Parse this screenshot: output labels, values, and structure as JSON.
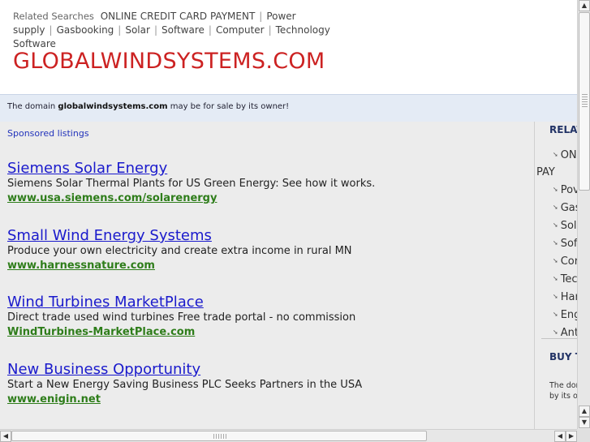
{
  "topbar": {
    "label": "Related Searches",
    "links": [
      "ONLINE CREDIT CARD PAYMENT",
      "Power supply",
      "Gasbooking",
      "Solar",
      "Software",
      "Computer",
      "Technology",
      "Software"
    ]
  },
  "site": {
    "title": "GLOBALWINDSYSTEMS.COM"
  },
  "notice": {
    "prefix": "The domain",
    "domain": "globalwindsystems.com",
    "suffix": "may be for sale by its owner!"
  },
  "main": {
    "sponsored_label": "Sponsored listings",
    "listings": [
      {
        "title": "Siemens Solar Energy",
        "desc": "Siemens Solar Thermal Plants for US Green Energy: See how it works.",
        "url": "www.usa.siemens.com/solarenergy"
      },
      {
        "title": "Small Wind Energy Systems",
        "desc": "Produce your own electricity and create extra income in rural MN",
        "url": "www.harnessnature.com"
      },
      {
        "title": "Wind Turbines MarketPlace",
        "desc": "Direct trade used wind turbines Free trade portal - no commission",
        "url": "WindTurbines-MarketPlace.com"
      },
      {
        "title": "New Business Opportunity",
        "desc": "Start a New Energy Saving Business PLC Seeks Partners in the USA",
        "url": "www.enigin.net"
      }
    ]
  },
  "right_panel": {
    "heading": "RELAT",
    "items": [
      "ON",
      "PAY",
      "Pov",
      "Gas",
      "Sol",
      "Sof",
      "Cor",
      "Tec",
      "Har",
      "Eng",
      "Ant"
    ],
    "heading2": "BUY T",
    "text_line1": "The dom",
    "text_line2": "by its ov"
  },
  "icons": {
    "bullet": "arrow-bullet-icon",
    "scroll_up": "scroll-up-arrow-icon",
    "scroll_down": "scroll-down-arrow-icon",
    "scroll_left": "scroll-left-arrow-icon",
    "scroll_right": "scroll-right-arrow-icon"
  },
  "colors": {
    "title": "#cc2222",
    "link": "#1a1acc",
    "url": "#2e7d1a",
    "notice_bg": "#e4ebf5"
  }
}
